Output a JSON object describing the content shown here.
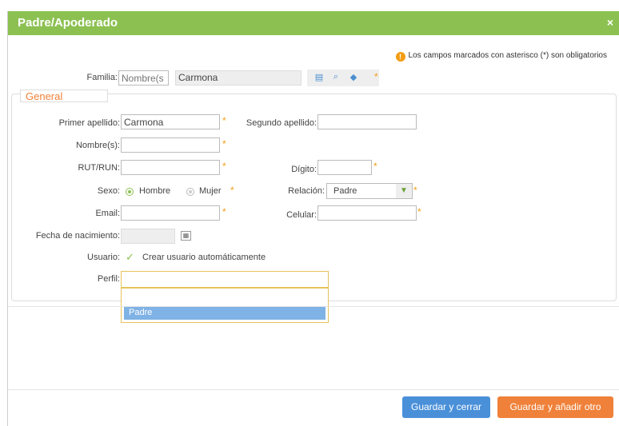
{
  "modal": {
    "title": "Padre/Apoderado",
    "close": "×"
  },
  "notice": "Los campos marcados con asterisco (*) son obligatorios",
  "familia": {
    "label": "Familia:",
    "placeholder": "Nombre(s",
    "value": "Carmona"
  },
  "section": {
    "legend": "General"
  },
  "fields": {
    "primer_apellido": {
      "label": "Primer apellido:",
      "value": "Carmona"
    },
    "segundo_apellido": {
      "label": "Segundo apellido:",
      "value": ""
    },
    "nombres": {
      "label": "Nombre(s):",
      "value": ""
    },
    "rut": {
      "label": "RUT/RUN:",
      "value": ""
    },
    "digito": {
      "label": "Dígito:",
      "value": ""
    },
    "sexo": {
      "label": "Sexo:",
      "hombre": "Hombre",
      "mujer": "Mujer"
    },
    "relacion": {
      "label": "Relación:",
      "value": "Padre"
    },
    "email": {
      "label": "Email:",
      "value": ""
    },
    "celular": {
      "label": "Celular:",
      "value": ""
    },
    "fecha": {
      "label": "Fecha de nacimiento:",
      "value": ""
    },
    "usuario": {
      "label": "Usuario:",
      "checkbox": "Crear usuario automáticamente"
    },
    "perfil": {
      "label": "Perfil:",
      "value": "",
      "option": "Padre"
    }
  },
  "required_mark": "*",
  "buttons": {
    "save_close": "Guardar y cerrar",
    "save_add": "Guardar y añadir otro"
  },
  "icons": [
    "card-icon",
    "search-icon",
    "eraser-icon",
    "calendar-icon",
    "check-icon",
    "warning-icon"
  ]
}
